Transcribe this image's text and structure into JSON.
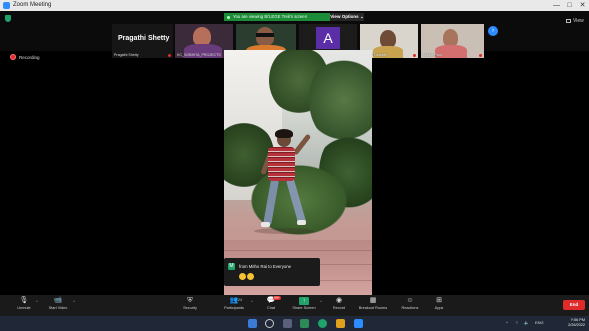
{
  "window": {
    "title": "Zoom Meeting",
    "controls": [
      "—",
      "□",
      "✕"
    ]
  },
  "top": {
    "share_banner": "You are viewing Bi'LEGE Trek's screen",
    "view_options": "View Options ⌄",
    "view_label": "View",
    "participants": [
      {
        "name": "Pragathi Shetty",
        "big_name": "Pragathi Shetty"
      },
      {
        "name": "KC_SOBHITA_PROJECTS"
      },
      {
        "name": "CHANDAN"
      },
      {
        "name": "Amber Barroo",
        "letter": "A"
      },
      {
        "name": "PROVIT Aenjay"
      },
      {
        "name": "Sobha Paul"
      }
    ]
  },
  "recording": {
    "label": "Recording"
  },
  "toast": {
    "avatar_letter": "M",
    "message": "from Mitho Rai to Everyone"
  },
  "toolbar": {
    "items": [
      {
        "label": "Unmute",
        "icon": "microphone-icon"
      },
      {
        "label": "Start Video",
        "icon": "video-camera-icon"
      },
      {
        "label": "Security",
        "icon": "shield-icon"
      },
      {
        "label": "Participants",
        "icon": "participants-icon",
        "count": "24"
      },
      {
        "label": "Chat",
        "icon": "chat-icon",
        "badge": "99+"
      },
      {
        "label": "Share Screen",
        "icon": "share-screen-icon"
      },
      {
        "label": "Record",
        "icon": "record-icon"
      },
      {
        "label": "Breakout Rooms",
        "icon": "breakout-rooms-icon"
      },
      {
        "label": "Reactions",
        "icon": "reactions-icon"
      },
      {
        "label": "Apps",
        "icon": "apps-icon"
      }
    ],
    "end_label": "End"
  },
  "taskbar": {
    "tray": "ENG",
    "time": "Y:56 PM",
    "date": "2/26/2022"
  },
  "colors": {
    "zoom_blue": "#2d8cff",
    "share_green": "#1d8c39",
    "end_red": "#e02b2b",
    "toolbar_bg": "#1a1a1a"
  }
}
